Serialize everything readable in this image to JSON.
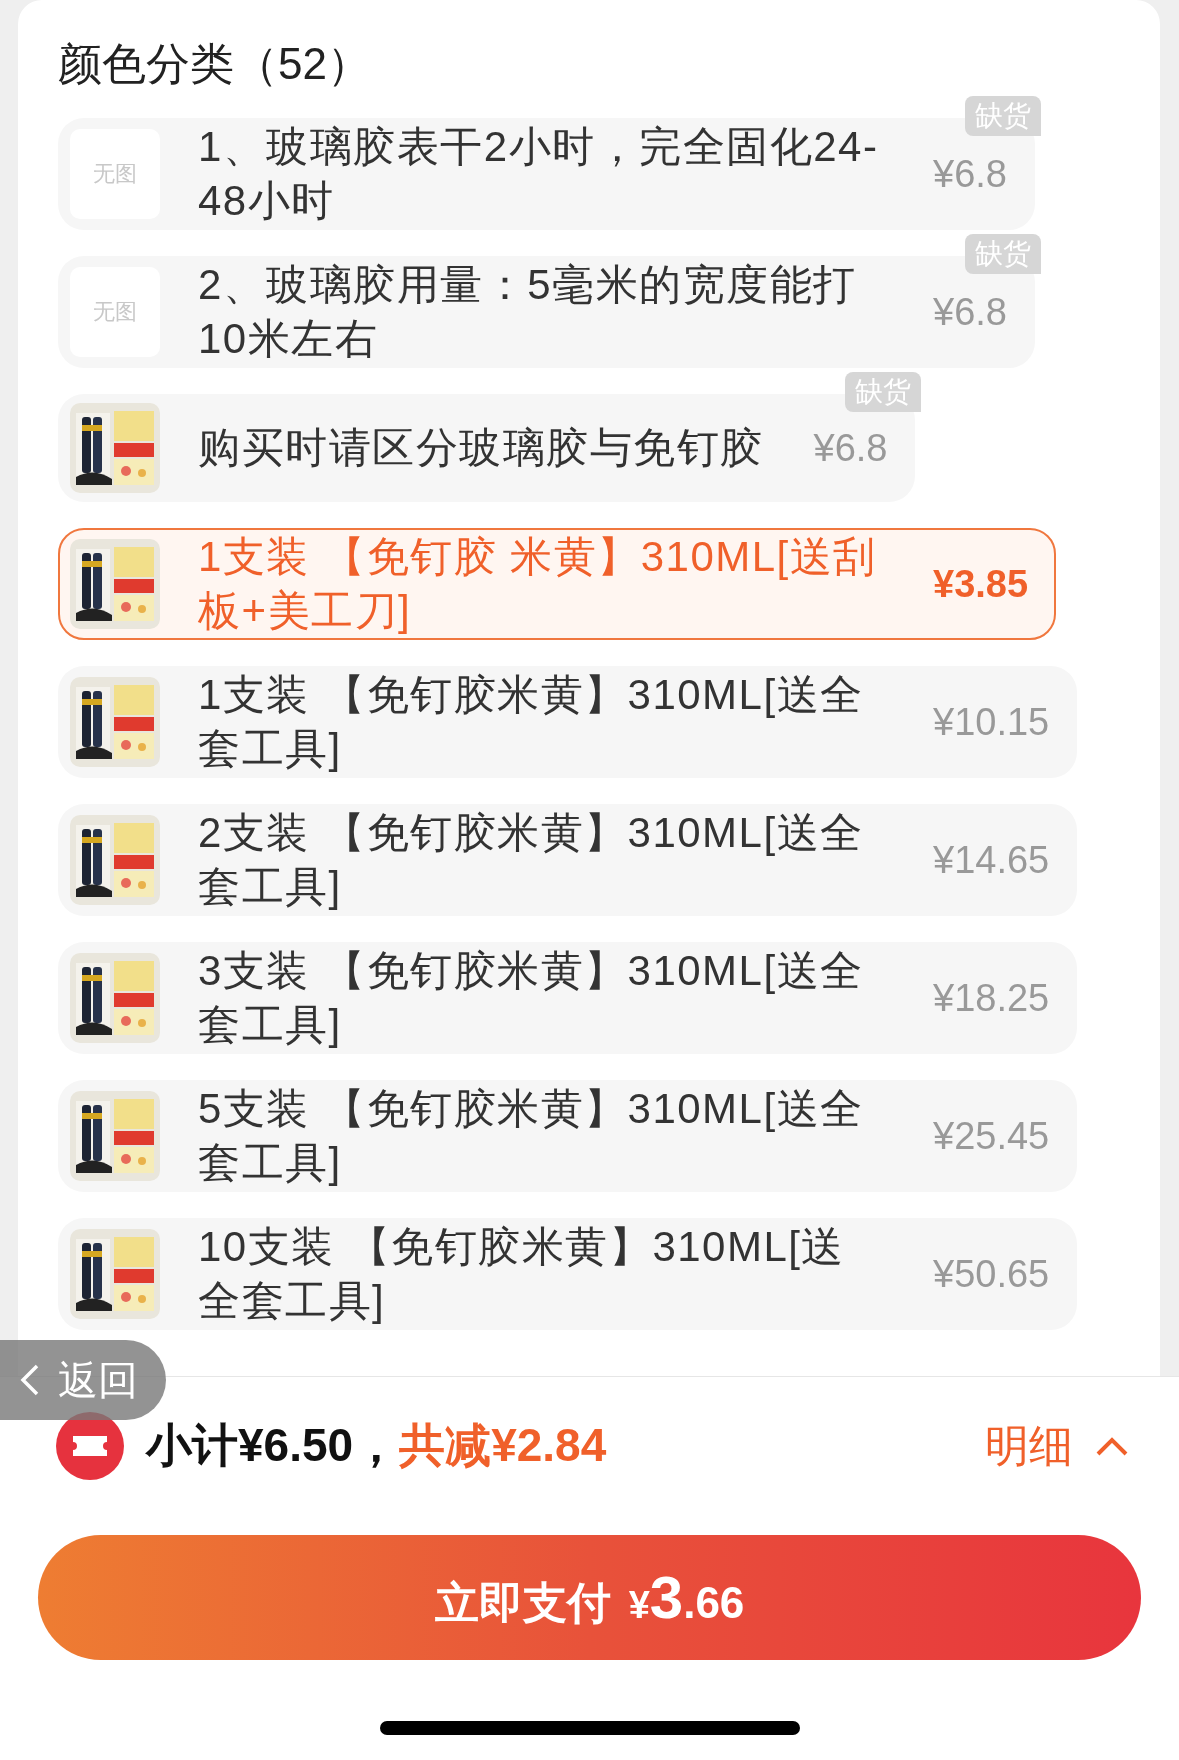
{
  "title": "颜色分类（52）",
  "options": [
    {
      "image": {
        "kind": "placeholder",
        "text": "无图"
      },
      "name": "1、玻璃胶表干2小时，完全固化24-48小时",
      "price": "¥6.8",
      "badge": "缺货",
      "selected": false
    },
    {
      "image": {
        "kind": "placeholder",
        "text": "无图"
      },
      "name": "2、玻璃胶用量：5毫米的宽度能打10米左右",
      "price": "¥6.8",
      "badge": "缺货",
      "selected": false
    },
    {
      "name": "购买时请区分玻璃胶与免钉胶",
      "price": "¥6.8",
      "badge": "缺货",
      "selected": false
    },
    {
      "name": "1支装 【免钉胶 米黄】310ML[送刮板+美工刀]",
      "price": "¥3.85",
      "selected": true
    },
    {
      "name": "1支装 【免钉胶米黄】310ML[送全套工具]",
      "price": "¥10.15",
      "selected": false
    },
    {
      "name": "2支装 【免钉胶米黄】310ML[送全套工具]",
      "price": "¥14.65",
      "selected": false
    },
    {
      "name": "3支装 【免钉胶米黄】310ML[送全套工具]",
      "price": "¥18.25",
      "selected": false
    },
    {
      "name": "5支装 【免钉胶米黄】310ML[送全套工具]",
      "price": "¥25.45",
      "selected": false
    },
    {
      "name": "10支装 【免钉胶米黄】310ML[送全套工具]",
      "price": "¥50.65",
      "selected": false
    }
  ],
  "back_button": {
    "label": "返回"
  },
  "summary": {
    "subtotal": "小计¥6.50，",
    "discount": "共减¥2.84",
    "details_link": "明细"
  },
  "pay_button": {
    "label": "立即支付",
    "currency": "¥",
    "amount_integer": "3",
    "amount_decimal": ".66"
  }
}
